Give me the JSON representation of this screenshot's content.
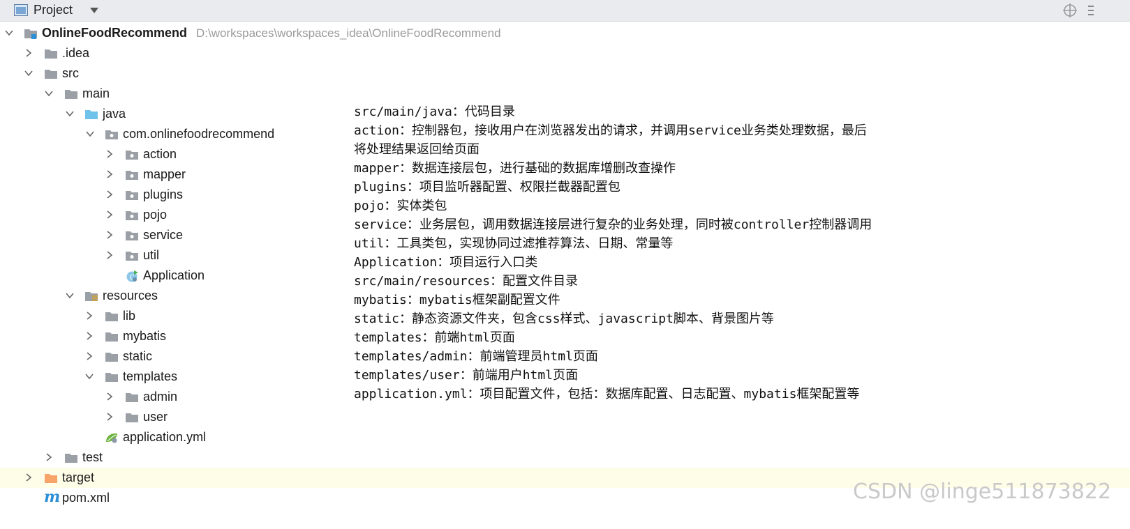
{
  "panel": {
    "title": "Project",
    "icons": [
      "project-icon",
      "dropdown-caret-icon",
      "locate-target-icon",
      "more-options-icon"
    ]
  },
  "tree": [
    {
      "label": "OnlineFoodRecommend",
      "path": "D:\\workspaces\\workspaces_idea\\OnlineFoodRecommend",
      "expanded": true,
      "icon": "module-folder-icon"
    },
    {
      "label": ".idea",
      "expanded": false,
      "icon": "folder-icon"
    },
    {
      "label": "src",
      "expanded": true,
      "icon": "folder-icon"
    },
    {
      "label": "main",
      "expanded": true,
      "icon": "folder-icon"
    },
    {
      "label": "java",
      "expanded": true,
      "icon": "source-root-folder-icon"
    },
    {
      "label": "com.onlinefoodrecommend",
      "expanded": true,
      "icon": "package-icon"
    },
    {
      "label": "action",
      "expanded": false,
      "icon": "package-icon"
    },
    {
      "label": "mapper",
      "expanded": false,
      "icon": "package-icon"
    },
    {
      "label": "plugins",
      "expanded": false,
      "icon": "package-icon"
    },
    {
      "label": "pojo",
      "expanded": false,
      "icon": "package-icon"
    },
    {
      "label": "service",
      "expanded": false,
      "icon": "package-icon"
    },
    {
      "label": "util",
      "expanded": false,
      "icon": "package-icon"
    },
    {
      "label": "Application",
      "icon": "spring-boot-class-icon"
    },
    {
      "label": "resources",
      "expanded": true,
      "icon": "resources-root-folder-icon"
    },
    {
      "label": "lib",
      "expanded": false,
      "icon": "folder-icon"
    },
    {
      "label": "mybatis",
      "expanded": false,
      "icon": "folder-icon"
    },
    {
      "label": "static",
      "expanded": false,
      "icon": "folder-icon"
    },
    {
      "label": "templates",
      "expanded": true,
      "icon": "folder-icon"
    },
    {
      "label": "admin",
      "expanded": false,
      "icon": "folder-icon"
    },
    {
      "label": "user",
      "expanded": false,
      "icon": "folder-icon"
    },
    {
      "label": "application.yml",
      "icon": "spring-yml-file-icon"
    },
    {
      "label": "test",
      "expanded": false,
      "icon": "folder-icon"
    },
    {
      "label": "target",
      "expanded": false,
      "icon": "excluded-folder-icon",
      "highlighted": true
    },
    {
      "label": "pom.xml",
      "icon": "maven-icon"
    }
  ],
  "notes": [
    "src/main/java：代码目录",
    "action：控制器包，接收用户在浏览器发出的请求，并调用service业务类处理数据，最后",
    "将处理结果返回给页面",
    "mapper：数据连接层包，进行基础的数据库增删改查操作",
    "plugins：项目监听器配置、权限拦截器配置包",
    "pojo：实体类包",
    "service：业务层包，调用数据连接层进行复杂的业务处理，同时被controller控制器调用",
    "util：工具类包，实现协同过滤推荐算法、日期、常量等",
    "Application：项目运行入口类",
    "src/main/resources：配置文件目录",
    "mybatis：mybatis框架副配置文件",
    "static：静态资源文件夹，包含css样式、javascript脚本、背景图片等",
    "templates：前端html页面",
    "templates/admin：前端管理员html页面",
    "templates/user：前端用户html页面",
    "application.yml：项目配置文件，包括：数据库配置、日志配置、mybatis框架配置等"
  ],
  "watermark": "CSDN @linge511873822",
  "colors": {
    "header_bg": "#e9ebef",
    "folder_gray": "#9aa0a6",
    "source_blue": "#6fc3ea",
    "excluded_orange": "#f6a46a",
    "highlight_row": "#fdfde8",
    "path_gray": "#9a9a9a"
  }
}
